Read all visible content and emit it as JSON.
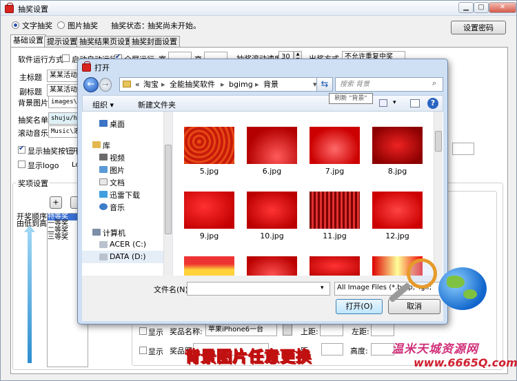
{
  "window": {
    "title": "抽奖设置",
    "set_password": "设置密码",
    "mode_text": "文字抽奖",
    "mode_image": "图片抽奖",
    "status_label": "抽奖状态：",
    "status_value": "抽奖尚未开始。"
  },
  "tabs": [
    "基础设置",
    "提示设置",
    "抽奖结果页设置",
    "抽奖封面设置"
  ],
  "basic": {
    "run_mode_label": "软件运行方式",
    "autostart_label": "启动自动运行",
    "fullscreen_label": "全屏运行",
    "width_label": "宽",
    "height_label": "高",
    "scroll_speed_label": "抽奖滚动速度",
    "scroll_speed_value": "30",
    "draw_mode_label": "出奖方式",
    "draw_mode_value": "不允许重复中奖",
    "main_title_label": "主标题",
    "main_title_value": "某某活动",
    "sub_title_label": "副标题",
    "sub_title_value": "某某活动",
    "bg_image_label": "背景图片",
    "bg_image_value": "images\\b",
    "list_label": "抽奖名单",
    "list_value": "shuju/ha",
    "music_label": "滚动音乐",
    "music_value": "Music\\滚",
    "show_button_label": "显示抽奖按钮",
    "show_button_extra": "开",
    "show_logo_label": "显示logo",
    "show_logo_extra": "Lo"
  },
  "prizes": {
    "group_label": "奖项设置",
    "add_btn": "+",
    "order_label_1": "开奖顺序",
    "order_label_2": "由低到高",
    "items": [
      "特等奖",
      "一等奖",
      "二等奖",
      "三等奖"
    ],
    "row1_show": "显示",
    "row1_name_label": "奖品名称:",
    "row1_name_value": "苹果iPhone6一台",
    "row1_top_label": "上距:",
    "row1_left_label": "左距:",
    "row2_show": "显示",
    "row2_img_label": "奖品图",
    "row2_img_extra": "距",
    "row2_height_label": "高度:"
  },
  "dialog": {
    "title": "打开",
    "path": [
      "«",
      "淘宝",
      "全能抽奖软件",
      "bgimg",
      "背景"
    ],
    "search_placeholder": "搜索 背景",
    "refresh_tip": "刷新 \"背景\"",
    "organize": "组织 ▾",
    "new_folder": "新建文件夹",
    "nav": [
      {
        "label": "桌面",
        "icon": "desktop-icon"
      },
      {
        "label": "库",
        "icon": "library-icon"
      },
      {
        "label": "视频",
        "icon": "video-icon"
      },
      {
        "label": "图片",
        "icon": "pictures-icon"
      },
      {
        "label": "文档",
        "icon": "documents-icon"
      },
      {
        "label": "迅雷下载",
        "icon": "download-icon"
      },
      {
        "label": "音乐",
        "icon": "music-icon"
      },
      {
        "label": "计算机",
        "icon": "computer-icon"
      },
      {
        "label": "ACER (C:)",
        "icon": "drive-icon"
      },
      {
        "label": "DATA (D:)",
        "icon": "drive-icon"
      }
    ],
    "files": [
      "5.jpg",
      "6.jpg",
      "7.jpg",
      "8.jpg",
      "9.jpg",
      "10.jpg",
      "11.jpg",
      "12.jpg"
    ],
    "filename_label": "文件名(N):",
    "filter_value": "All Image Files (*.bmp;*.gif;",
    "open_btn": "打开(O)",
    "cancel_btn": "取消"
  },
  "caption": "背景图片任意更换",
  "watermark": {
    "brand": "温米天城资源网",
    "url": "www.6665Q.com"
  },
  "colors": {
    "accent": "#2a4fae",
    "caption_fill": "#f2e02a",
    "caption_stroke": "#c01010",
    "red": "#d8241f"
  }
}
